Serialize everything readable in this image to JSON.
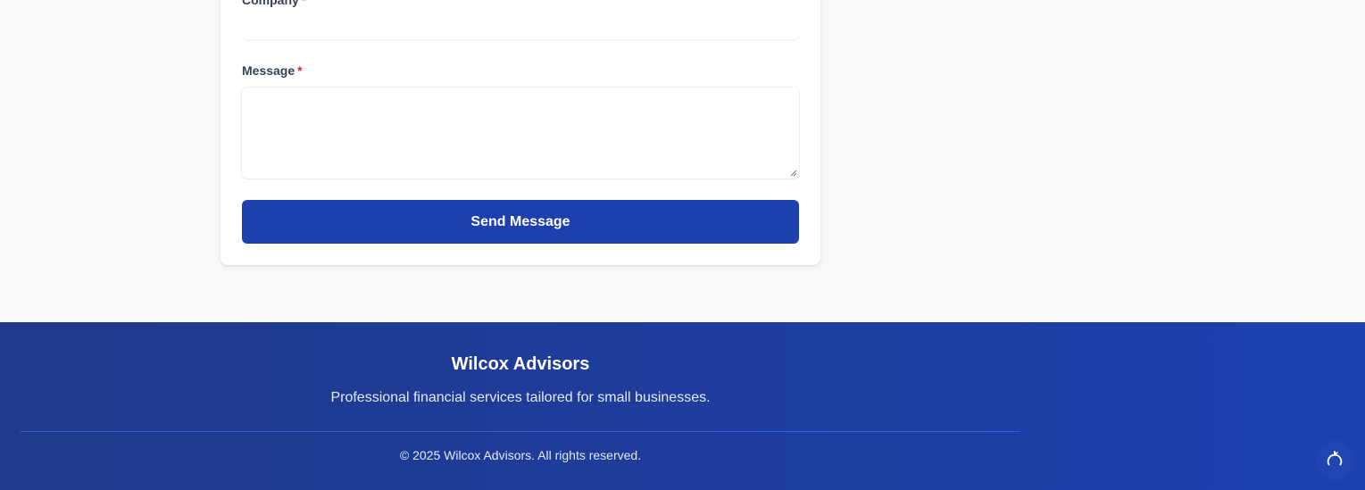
{
  "form": {
    "company_label": "Company",
    "company_value": "",
    "message_label": "Message",
    "message_value": "",
    "required_marker": "*",
    "submit_label": "Send Message"
  },
  "footer": {
    "brand": "Wilcox Advisors",
    "tagline": "Professional financial services tailored for small businesses.",
    "copyright": "© 2025 Wilcox Advisors. All rights reserved."
  },
  "floating_button": {
    "icon": "refresh-icon"
  },
  "colors": {
    "page_background": "#f8f9fb",
    "card_background": "#ffffff",
    "primary": "#1e40af",
    "footer_gradient_start": "#1e3a8a",
    "footer_gradient_end": "#1e40af",
    "required": "#dc2626",
    "label_text": "#374151"
  }
}
